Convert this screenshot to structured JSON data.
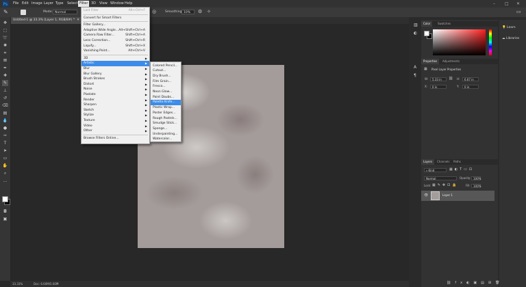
{
  "menubar": {
    "items": [
      "File",
      "Edit",
      "Image",
      "Layer",
      "Type",
      "Select",
      "Filter",
      "3D",
      "View",
      "Window",
      "Help"
    ],
    "active": "Filter"
  },
  "options": {
    "mode_label": "Mode:",
    "mode_value": "Normal",
    "smoothing_label": "Smoothing:",
    "smoothing_value": "10%"
  },
  "document": {
    "tab_title": "Untitled-1 @ 33.3% (Layer 1, RGB/8#) *"
  },
  "status": {
    "zoom": "33.33%",
    "doc_info": "Doc: 6.60M/5.60M"
  },
  "filter_menu": {
    "items": [
      {
        "label": "Last Filter",
        "shortcut": "Alt+Ctrl+F",
        "disabled": true
      },
      {
        "sep": true
      },
      {
        "label": "Convert for Smart Filters"
      },
      {
        "sep": true
      },
      {
        "label": "Filter Gallery..."
      },
      {
        "label": "Adaptive Wide Angle...",
        "shortcut": "Alt+Shift+Ctrl+A"
      },
      {
        "label": "Camera Raw Filter...",
        "shortcut": "Shift+Ctrl+A"
      },
      {
        "label": "Lens Correction...",
        "shortcut": "Shift+Ctrl+R"
      },
      {
        "label": "Liquify...",
        "shortcut": "Shift+Ctrl+X"
      },
      {
        "label": "Vanishing Point...",
        "shortcut": "Alt+Ctrl+V"
      },
      {
        "sep": true
      },
      {
        "label": "3D",
        "submenu": true
      },
      {
        "label": "Artistic",
        "submenu": true,
        "highlighted": true
      },
      {
        "label": "Blur",
        "submenu": true
      },
      {
        "label": "Blur Gallery",
        "submenu": true
      },
      {
        "label": "Brush Strokes",
        "submenu": true
      },
      {
        "label": "Distort",
        "submenu": true
      },
      {
        "label": "Noise",
        "submenu": true
      },
      {
        "label": "Pixelate",
        "submenu": true
      },
      {
        "label": "Render",
        "submenu": true
      },
      {
        "label": "Sharpen",
        "submenu": true
      },
      {
        "label": "Sketch",
        "submenu": true
      },
      {
        "label": "Stylize",
        "submenu": true
      },
      {
        "label": "Texture",
        "submenu": true
      },
      {
        "label": "Video",
        "submenu": true
      },
      {
        "label": "Other",
        "submenu": true
      },
      {
        "sep": true
      },
      {
        "label": "Browse Filters Online..."
      }
    ]
  },
  "artistic_menu": {
    "items": [
      "Colored Pencil...",
      "Cutout...",
      "Dry Brush...",
      "Film Grain...",
      "Fresco...",
      "Neon Glow...",
      "Paint Daubs...",
      "Palette Knife...",
      "Plastic Wrap...",
      "Poster Edges...",
      "Rough Pastels...",
      "Smudge Stick...",
      "Sponge...",
      "Underpainting...",
      "Watercolor..."
    ],
    "highlighted": "Palette Knife..."
  },
  "panels": {
    "color_tabs": [
      "Color",
      "Swatches"
    ],
    "properties_tabs": [
      "Properties",
      "Adjustments"
    ],
    "properties_title": "Pixel Layer Properties",
    "w_label": "W:",
    "w_value": "5.33 in",
    "h_label": "H:",
    "h_value": "6.67 in",
    "x_label": "X:",
    "x_value": "0 in",
    "y_label": "Y:",
    "y_value": "0 in",
    "layers_tabs": [
      "Layers",
      "Channels",
      "Paths"
    ],
    "kind_value": "Kind",
    "blend_value": "Normal",
    "opacity_label": "Opacity:",
    "opacity_value": "100%",
    "lock_label": "Lock:",
    "fill_label": "Fill:",
    "fill_value": "100%",
    "layer_name": "Layer 1"
  },
  "right_dock": {
    "learn": "Learn",
    "libraries": "Libraries"
  },
  "colors": {
    "accent": "#3b8ce8",
    "foreground": "#ffffff",
    "background": "#000000"
  }
}
